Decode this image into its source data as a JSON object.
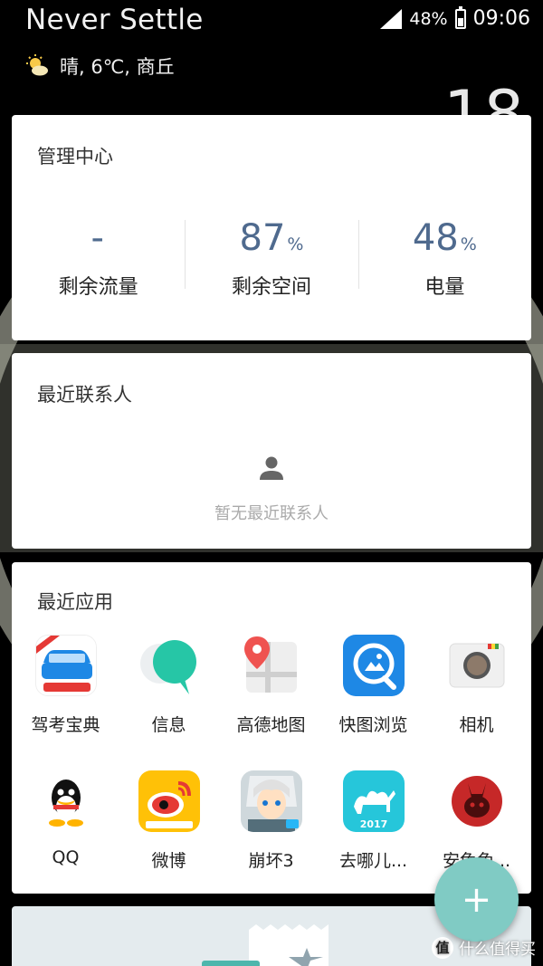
{
  "header": {
    "title": "Never Settle",
    "battery_percent": "48%",
    "time": "09:06"
  },
  "weather": {
    "icon": "sun-cloud-icon",
    "text": "晴, 6℃, 商丘"
  },
  "management_card": {
    "title": "管理中心",
    "stats": [
      {
        "value": "-",
        "unit": "",
        "label": "剩余流量"
      },
      {
        "value": "87",
        "unit": "%",
        "label": "剩余空间"
      },
      {
        "value": "48",
        "unit": "%",
        "label": "电量"
      }
    ]
  },
  "contacts_card": {
    "title": "最近联系人",
    "empty_text": "暂无最近联系人"
  },
  "apps_card": {
    "title": "最近应用",
    "apps": [
      {
        "label": "驾考宝典",
        "icon": "jiakao-icon"
      },
      {
        "label": "信息",
        "icon": "messages-icon"
      },
      {
        "label": "高德地图",
        "icon": "amap-icon"
      },
      {
        "label": "快图浏览",
        "icon": "quickpic-icon"
      },
      {
        "label": "相机",
        "icon": "camera-icon"
      },
      {
        "label": "QQ",
        "icon": "qq-icon"
      },
      {
        "label": "微博",
        "icon": "weibo-icon"
      },
      {
        "label": "崩坏3",
        "icon": "honkai-icon"
      },
      {
        "label": "去哪儿...",
        "icon": "qunar-icon"
      },
      {
        "label": "安兔兔...",
        "icon": "antutu-icon"
      }
    ]
  },
  "fab": {
    "label": "+"
  },
  "watermark": {
    "badge": "值",
    "text": "什么值得买"
  },
  "colors": {
    "stat_value": "#4f6a8e",
    "fab": "#80cbc4",
    "background": "#000000"
  }
}
